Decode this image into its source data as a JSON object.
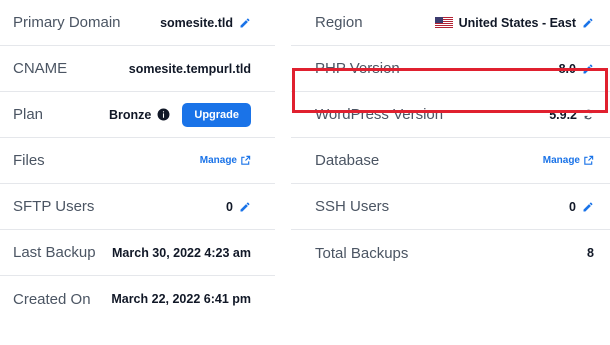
{
  "left": {
    "primary_domain": {
      "label": "Primary Domain",
      "value": "somesite.tld"
    },
    "cname": {
      "label": "CNAME",
      "value": "somesite.tempurl.tld"
    },
    "plan": {
      "label": "Plan",
      "value": "Bronze",
      "upgrade_label": "Upgrade"
    },
    "files": {
      "label": "Files",
      "link": "Manage"
    },
    "sftp_users": {
      "label": "SFTP Users",
      "value": "0"
    },
    "last_backup": {
      "label": "Last Backup",
      "value": "March 30, 2022 4:23 am"
    },
    "created_on": {
      "label": "Created On",
      "value": "March 22, 2022 6:41 pm"
    }
  },
  "right": {
    "region": {
      "label": "Region",
      "value": "United States - East",
      "flag_icon": "us-flag-icon"
    },
    "php_version": {
      "label": "PHP Version",
      "value": "8.0"
    },
    "wordpress_version": {
      "label": "WordPress Version",
      "value": "5.9.2"
    },
    "database": {
      "label": "Database",
      "link": "Manage"
    },
    "ssh_users": {
      "label": "SSH Users",
      "value": "0"
    },
    "total_backups": {
      "label": "Total Backups",
      "value": "8"
    }
  },
  "colors": {
    "accent": "#1a73e8",
    "highlight": "#e0202f"
  }
}
